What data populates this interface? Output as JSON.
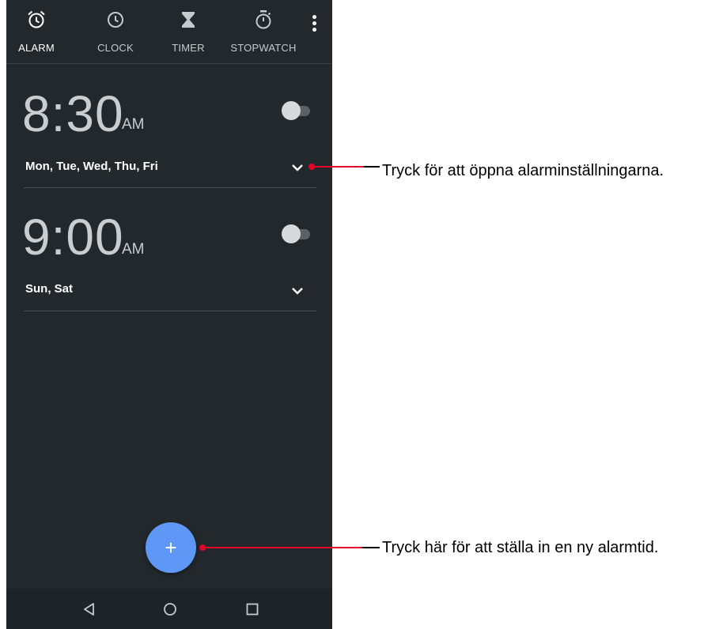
{
  "tabs": [
    {
      "label": "ALARM",
      "icon": "alarm-icon",
      "active": true
    },
    {
      "label": "CLOCK",
      "icon": "clock-icon",
      "active": false
    },
    {
      "label": "TIMER",
      "icon": "hourglass-icon",
      "active": false
    },
    {
      "label": "STOPWATCH",
      "icon": "stopwatch-icon",
      "active": false
    }
  ],
  "alarms": [
    {
      "time": "8:30",
      "ampm": "AM",
      "days": "Mon, Tue, Wed, Thu, Fri",
      "enabled": false
    },
    {
      "time": "9:00",
      "ampm": "AM",
      "days": "Sun, Sat",
      "enabled": false
    }
  ],
  "fab": {
    "label": "+"
  },
  "callouts": {
    "expand": "Tryck för att öppna alarminställningarna.",
    "add": "Tryck här för att ställa in en ny alarmtid."
  },
  "colors": {
    "background": "#22282c",
    "fab": "#5e97f6",
    "callout_accent": "#e4002b"
  }
}
